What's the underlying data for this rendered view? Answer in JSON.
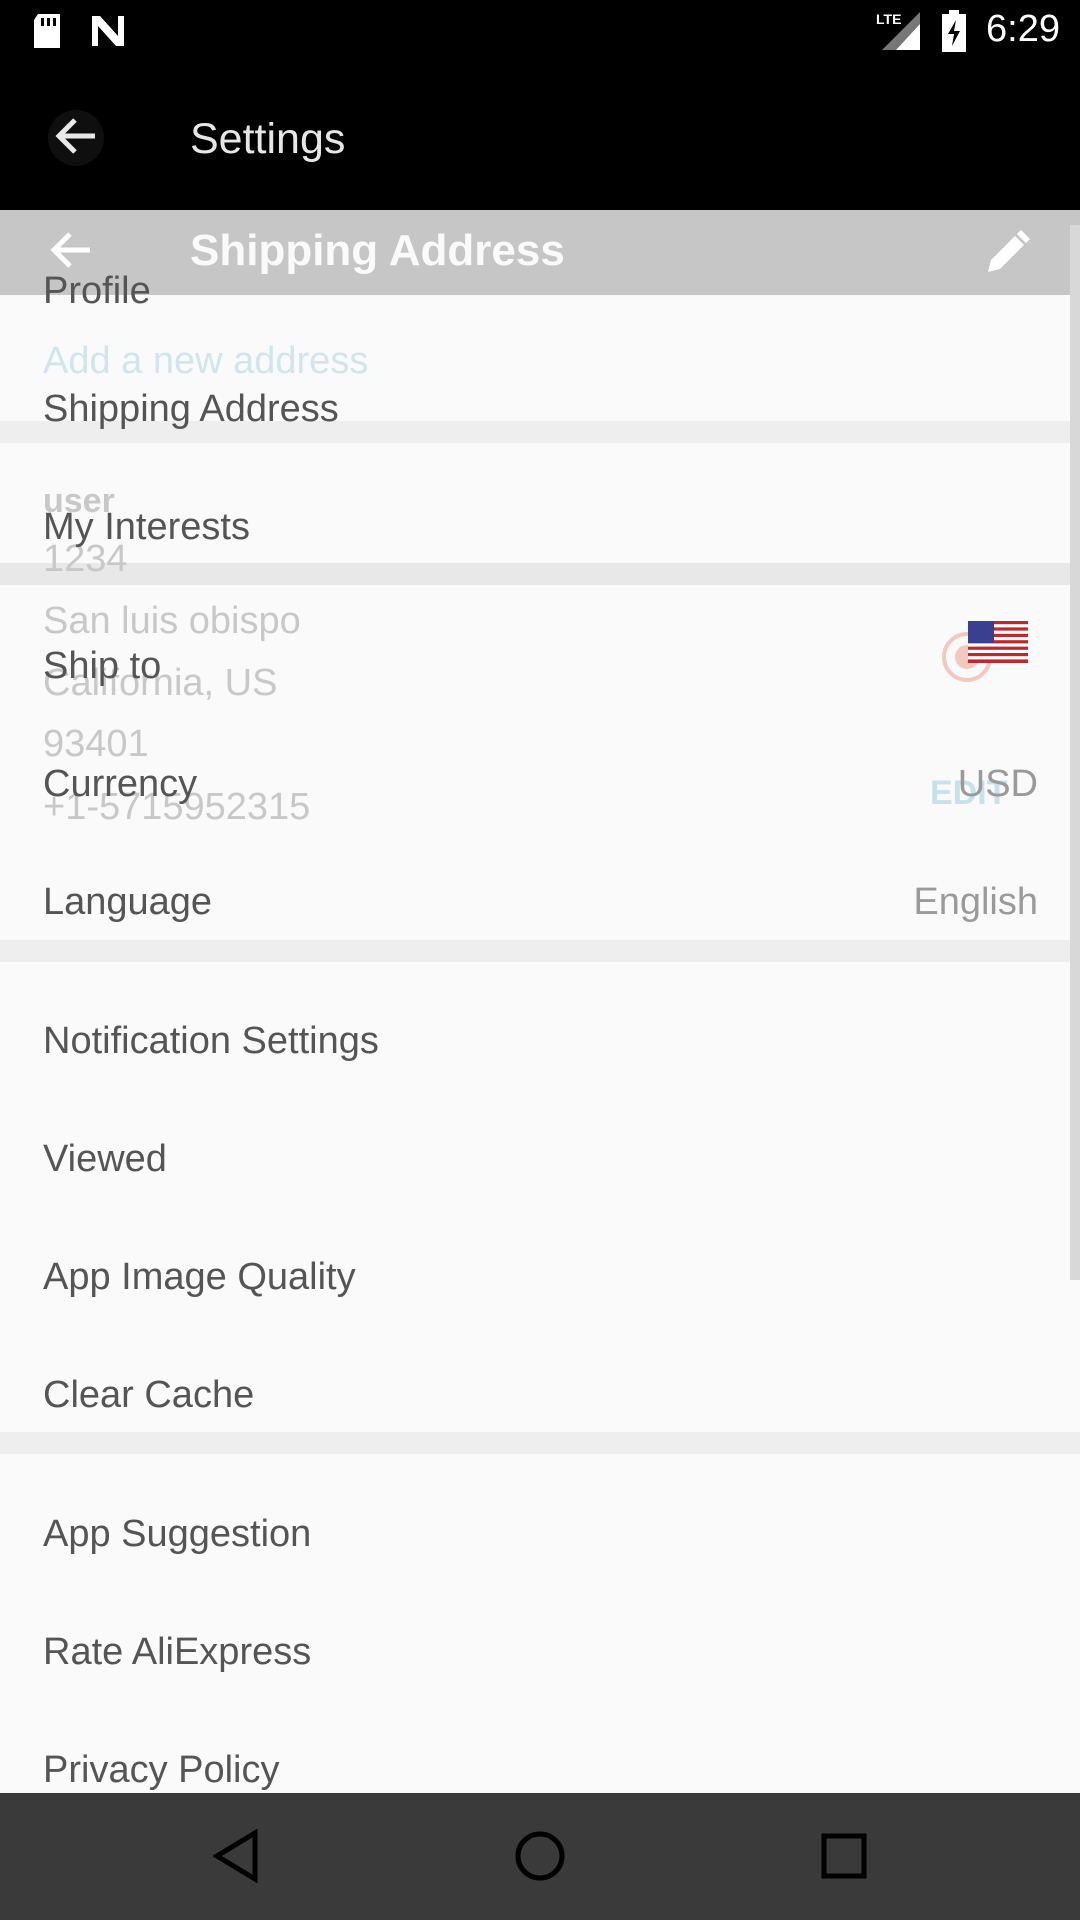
{
  "status_bar": {
    "time": "6:29",
    "network": "LTE"
  },
  "toolbar": {
    "title": "Settings"
  },
  "ghost": {
    "header_title": "Shipping Address",
    "add_address": "Add a new address",
    "name": "user",
    "street": "1234",
    "city": "San luis obispo",
    "state": "California, US",
    "zip": "93401",
    "phone": "+1-5715952315",
    "edit": "EDIT"
  },
  "settings": {
    "group1": [
      {
        "label": "Profile"
      },
      {
        "label": "Shipping Address"
      },
      {
        "label": "My Interests"
      }
    ],
    "group2": [
      {
        "label": "Ship to",
        "flag": "us-flag-icon"
      },
      {
        "label": "Currency",
        "value": "USD"
      },
      {
        "label": "Language",
        "value": "English"
      }
    ],
    "group3": [
      {
        "label": "Notification Settings"
      },
      {
        "label": "Viewed"
      },
      {
        "label": "App Image Quality"
      },
      {
        "label": "Clear Cache"
      }
    ],
    "group4": [
      {
        "label": "App Suggestion"
      },
      {
        "label": "Rate AliExpress"
      },
      {
        "label": "Privacy Policy"
      }
    ]
  },
  "colors": {
    "status": "#000000",
    "toolbar": "#000000",
    "navbar": "#3a3a3a",
    "text": "#555555",
    "muted": "#9a9a9a"
  }
}
